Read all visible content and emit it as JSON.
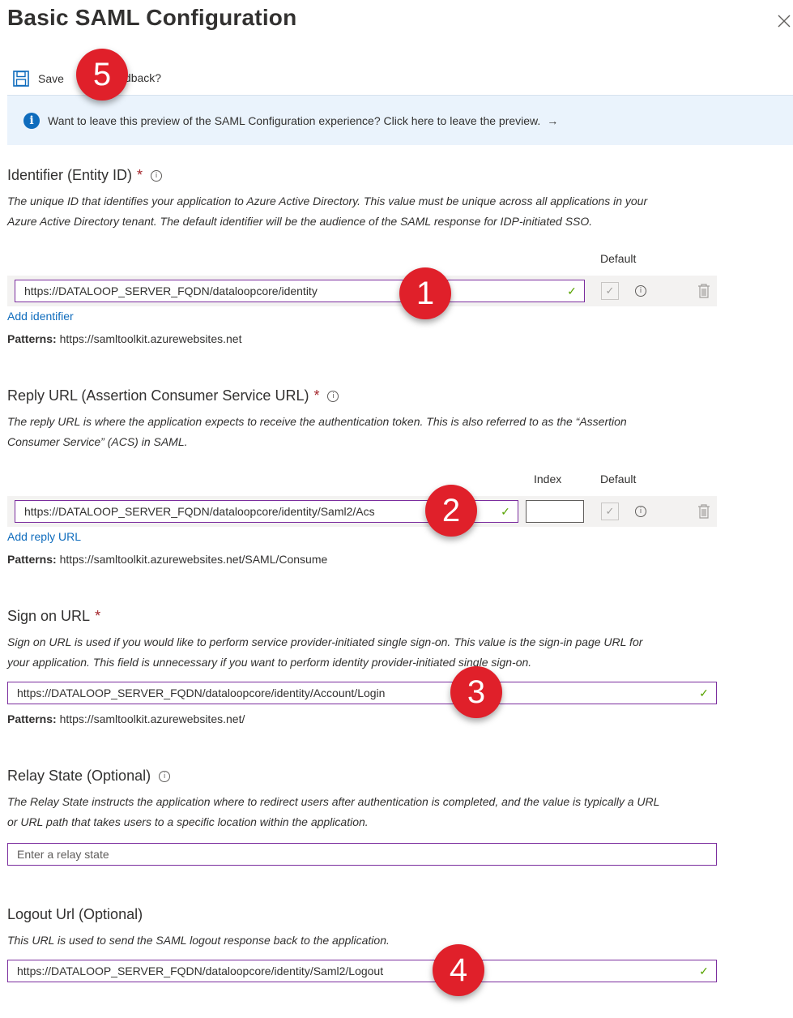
{
  "header": {
    "title": "Basic SAML Configuration",
    "close_icon": "close-icon"
  },
  "toolbar": {
    "save_label": "Save",
    "feedback_label": "Got feedback?",
    "save_icon": "save-icon"
  },
  "banner": {
    "text": "Want to leave this preview of the SAML Configuration experience? Click here to leave the preview.",
    "arrow": "→"
  },
  "identifier": {
    "label": "Identifier (Entity ID)",
    "required_mark": "*",
    "description_1": "The unique ID that identifies your application to Azure Active Directory. This value must be unique across all applications in your",
    "description_2": "Azure Active Directory tenant. The default identifier will be the audience of the SAML response for IDP-initiated SSO.",
    "default_header": "Default",
    "value": "https://DATALOOP_SERVER_FQDN/dataloopcore/identity",
    "add_link": "Add identifier",
    "patterns_label": "Patterns:",
    "patterns_value": "https://samltoolkit.azurewebsites.net"
  },
  "reply_url": {
    "label": "Reply URL (Assertion Consumer Service URL)",
    "required_mark": "*",
    "description_1": "The reply URL is where the application expects to receive the authentication token. This is also referred to as the “Assertion",
    "description_2": "Consumer Service” (ACS) in SAML.",
    "index_header": "Index",
    "default_header": "Default",
    "value": "https://DATALOOP_SERVER_FQDN/dataloopcore/identity/Saml2/Acs",
    "index_value": "",
    "add_link": "Add reply URL",
    "patterns_label": "Patterns:",
    "patterns_value": "https://samltoolkit.azurewebsites.net/SAML/Consume"
  },
  "sign_on": {
    "label": "Sign on URL",
    "required_mark": "*",
    "description_1": "Sign on URL is used if you would like to perform service provider-initiated single sign-on. This value is the sign-in page URL for",
    "description_2": "your application. This field is unnecessary if you want to perform identity provider-initiated single sign-on.",
    "value": "https://DATALOOP_SERVER_FQDN/dataloopcore/identity/Account/Login",
    "patterns_label": "Patterns:",
    "patterns_value": "https://samltoolkit.azurewebsites.net/"
  },
  "relay_state": {
    "label": "Relay State (Optional)",
    "description_1": "The Relay State instructs the application where to redirect users after authentication is completed, and the value is typically a URL",
    "description_2": "or URL path that takes users to a specific location within the application.",
    "placeholder": "Enter a relay state"
  },
  "logout": {
    "label": "Logout Url (Optional)",
    "description_1": "This URL is used to send the SAML logout response back to the application.",
    "value": "https://DATALOOP_SERVER_FQDN/dataloopcore/identity/Saml2/Logout"
  },
  "badges": [
    "1",
    "2",
    "3",
    "4",
    "5"
  ],
  "colors": {
    "accent": "#0f6cbd",
    "field_border": "#7b2d9e",
    "badge": "#e0202a",
    "check": "#57a300",
    "banner_bg": "#eaf3fc"
  }
}
